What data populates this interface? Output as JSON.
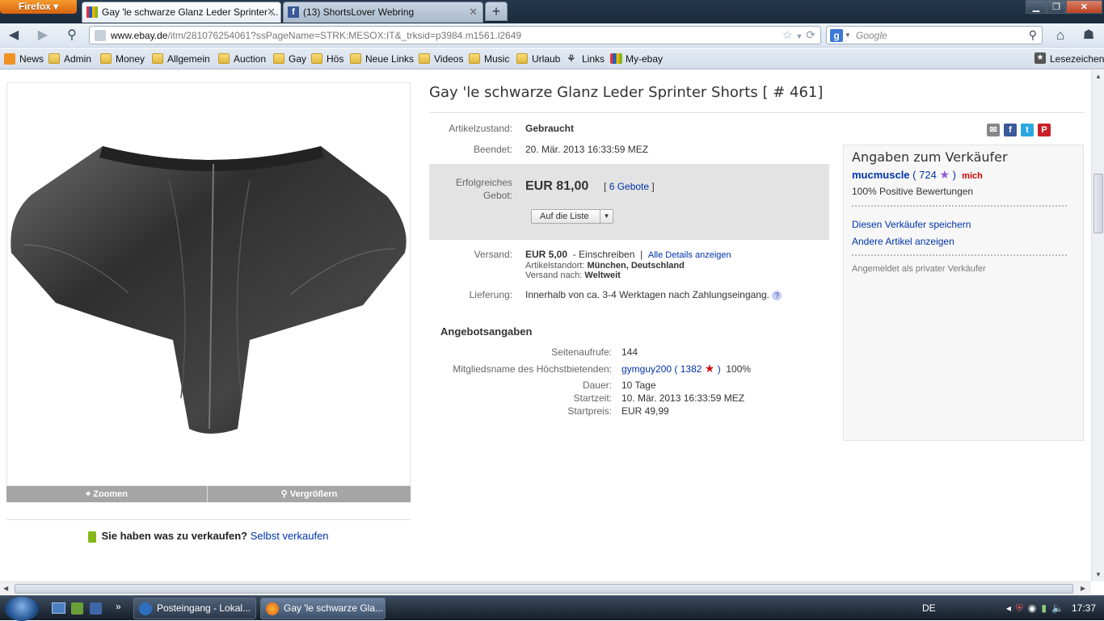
{
  "browser": {
    "menu_button": "Firefox",
    "tabs": [
      {
        "title": "Gay 'le schwarze Glanz Leder Sprinter ..."
      },
      {
        "title": "(13) ShortsLover Webring"
      }
    ],
    "url_domain": "www.ebay.de",
    "url_rest": "/itm/281076254061?ssPageName=STRK:MESOX:IT&_trksid=p3984.m1561.l2649",
    "url_prefix": "",
    "search_placeholder": "Google",
    "bookmarks": [
      "News",
      "Admin",
      "Money",
      "Allgemein",
      "Auction",
      "Gay",
      "Hös",
      "Neue Links",
      "Videos",
      "Music",
      "Urlaub",
      "Links",
      "My-ebay"
    ],
    "bookmarks_menu": "Lesezeichen"
  },
  "page": {
    "title": "Gay 'le schwarze Glanz Leder Sprinter Shorts [ # 461]",
    "image_controls": {
      "zoom": "Zoomen",
      "enlarge": "Vergrößern"
    },
    "sell": {
      "prompt": "Sie haben was zu verkaufen?",
      "link": "Selbst verkaufen"
    },
    "condition": {
      "label": "Artikelzustand:",
      "value": "Gebraucht"
    },
    "ended": {
      "label": "Beendet:",
      "value": "20. Mär. 2013 16:33:59 MEZ"
    },
    "bid": {
      "label": "Erfolgreiches Gebot:",
      "price": "EUR 81,00",
      "bids_open": "[",
      "bids_link": "6 Gebote",
      "bids_close": "]",
      "watch_button": "Auf die Liste"
    },
    "shipping": {
      "label": "Versand:",
      "price": "EUR 5,00",
      "method": "- Einschreiben",
      "sep": "|",
      "details_link": "Alle Details anzeigen",
      "location_label": "Artikelstandort:",
      "location": "München, Deutschland",
      "ships_to_label": "Versand nach:",
      "ships_to": "Weltweit"
    },
    "delivery": {
      "label": "Lieferung:",
      "value": "Innerhalb von ca. 3-4 Werktagen nach Zahlungseingang."
    },
    "offer": {
      "heading": "Angebotsangaben",
      "rows": [
        {
          "label": "Seitenaufrufe:",
          "value": "144"
        },
        {
          "label": "Mitgliedsname des Höchstbietenden:",
          "value": "gymguy200",
          "score": "1382",
          "pct": "100%"
        },
        {
          "label": "Dauer:",
          "value": "10 Tage"
        },
        {
          "label": "Startzeit:",
          "value": "10. Mär. 2013 16:33:59 MEZ"
        },
        {
          "label": "Startpreis:",
          "value": "EUR 49,99"
        }
      ]
    },
    "seller": {
      "heading": "Angaben zum Verkäufer",
      "name": "mucmuscle",
      "score": "724",
      "me_badge": "mich",
      "positive": "100% Positive Bewertungen",
      "save_link": "Diesen Verkäufer speichern",
      "other_link": "Andere Artikel anzeigen",
      "private_note": "Angemeldet als privater Verkäufer"
    }
  },
  "taskbar": {
    "items": [
      "Posteingang - Lokal...",
      "Gay 'le schwarze Gla..."
    ],
    "language": "DE",
    "clock": "17:37"
  },
  "colors": {
    "link": "#0033aa",
    "firefox_orange": "#e8761a",
    "bid_box": "#e3e3e3"
  }
}
